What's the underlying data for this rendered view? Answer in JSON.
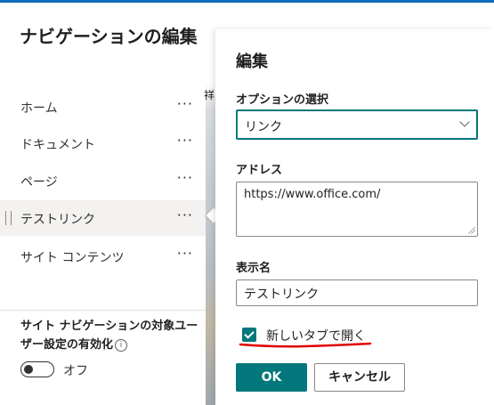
{
  "nav": {
    "title": "ナビゲーションの編集",
    "items": [
      {
        "label": "ホーム",
        "more": "···"
      },
      {
        "label": "ドキュメント",
        "more": "···"
      },
      {
        "label": "ページ",
        "more": "···"
      },
      {
        "label": "テストリンク",
        "more": "···"
      },
      {
        "label": "サイト コンテンツ",
        "more": "···"
      }
    ],
    "audience_setting": "サイト ナビゲーションの対象ユーザー設定の有効化",
    "info_icon": "i",
    "toggle_label": "オフ"
  },
  "background_fragment": "祥",
  "edit_panel": {
    "title": "編集",
    "option_label": "オプションの選択",
    "option_value": "リンク",
    "address_label": "アドレス",
    "address_value": "https://www.office.com/",
    "display_name_label": "表示名",
    "display_name_value": "テストリンク",
    "new_tab_label": "新しいタブで開く",
    "new_tab_checked": true,
    "ok_label": "OK",
    "cancel_label": "キャンセル"
  },
  "colors": {
    "accent": "#03787c",
    "top_bar": "#0f6cbd",
    "annotation": "#e00000"
  }
}
